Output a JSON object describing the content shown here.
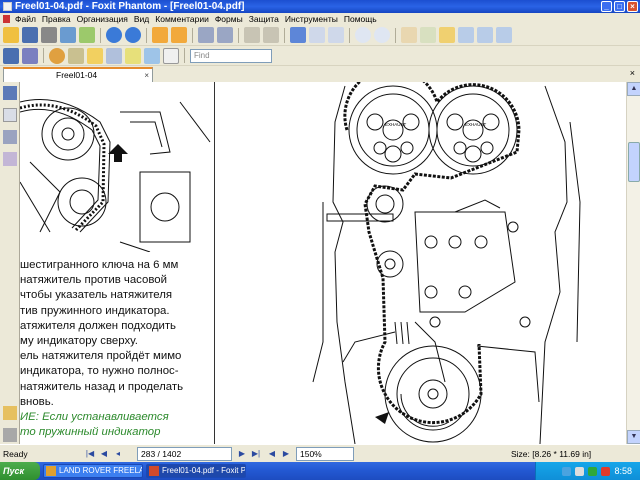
{
  "window": {
    "title": "Freel01-04.pdf - Foxit Phantom - [Freel01-04.pdf]"
  },
  "menu": [
    "Файл",
    "Правка",
    "Организация",
    "Вид",
    "Комментарии",
    "Формы",
    "Защита",
    "Инструменты",
    "Помощь"
  ],
  "toolbar": {
    "find_placeholder": "Find"
  },
  "tabs": [
    {
      "label": "Freel01-04"
    }
  ],
  "document": {
    "paragraph_lines": [
      "шестигранного ключа на 6 мм",
      "натяжитель против часовой",
      "чтобы указатель натяжителя",
      "тив пружинного индикатора.",
      "атяжителя должен подходить",
      "му индикатору сверху.",
      "ель натяжителя пройдёт мимо",
      "индикатора, то нужно полнос-",
      "натяжитель назад и проделать",
      "вновь."
    ],
    "note_lines": [
      "ИЕ: Если устанавливается",
      "то пружинный индикатор"
    ],
    "diagram_labels": [
      "EXHAUST",
      "EXHAUST"
    ]
  },
  "status": {
    "ready": "Ready",
    "page_indicator": "283 / 1402",
    "zoom": "150%",
    "page_size": "Size: [8.26 * 11.69 in]"
  },
  "taskbar": {
    "start": "Пуск",
    "tasks": [
      {
        "label": "LAND ROVER FREELAND..."
      },
      {
        "label": "Freel01-04.pdf - Foxit P..."
      }
    ],
    "clock": "8:58"
  },
  "colors": {
    "title_blue": "#2a63e6",
    "note_green": "#2c8a2c",
    "tab_accent": "#e68b2c"
  }
}
